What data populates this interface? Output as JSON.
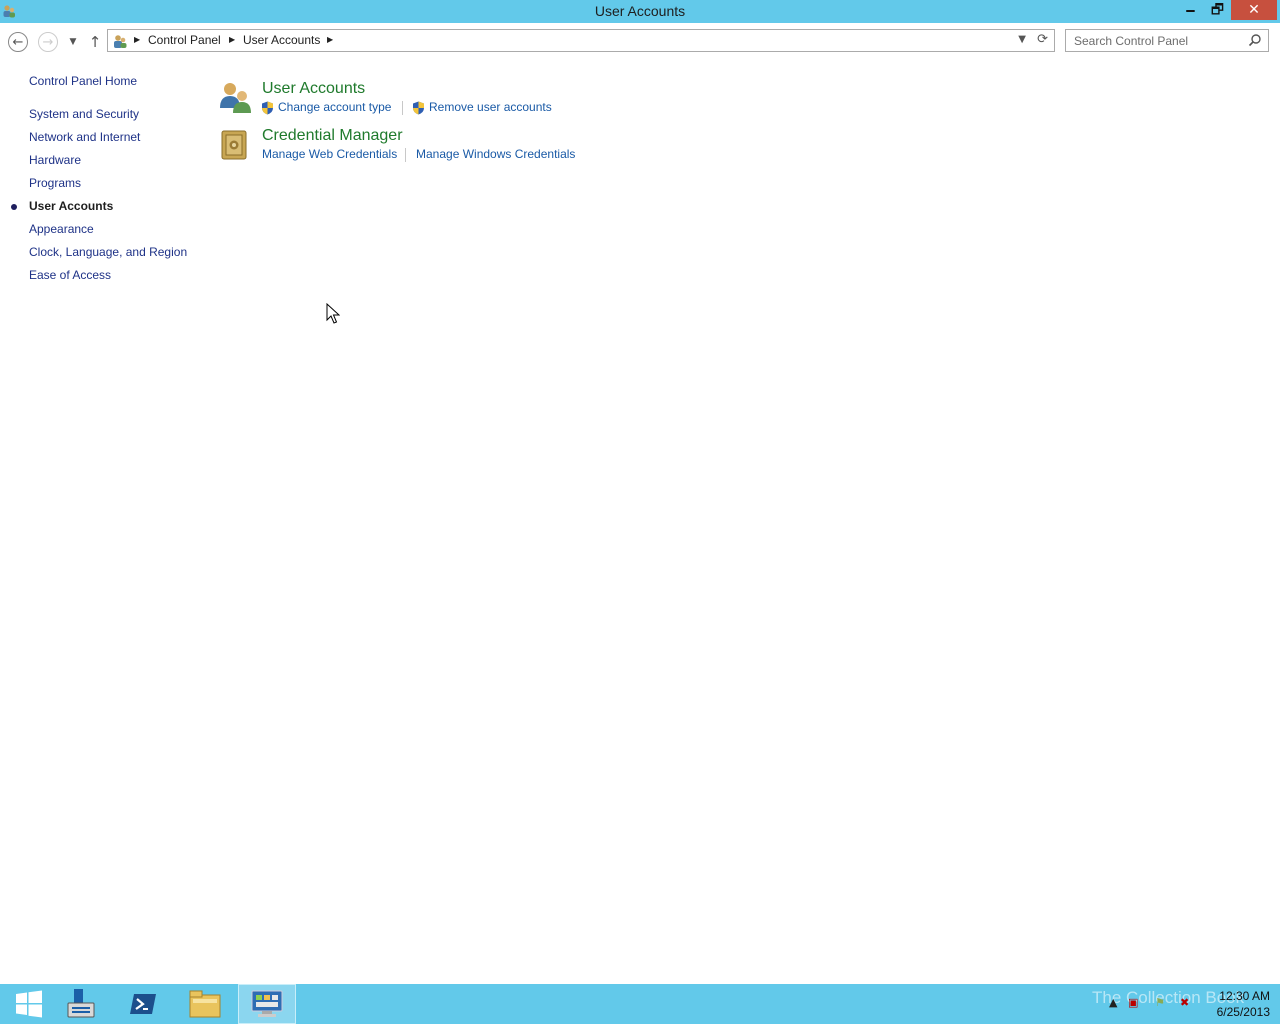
{
  "window": {
    "title": "User Accounts",
    "minimize_label": "🗕",
    "maximize_label": "🗗",
    "close_label": "✕"
  },
  "navigation": {
    "breadcrumbs": [
      "Control Panel",
      "User Accounts"
    ],
    "search_placeholder": "Search Control Panel"
  },
  "sidebar": {
    "home": "Control Panel Home",
    "items": [
      {
        "label": "System and Security",
        "active": false
      },
      {
        "label": "Network and Internet",
        "active": false
      },
      {
        "label": "Hardware",
        "active": false
      },
      {
        "label": "Programs",
        "active": false
      },
      {
        "label": "User Accounts",
        "active": true
      },
      {
        "label": "Appearance",
        "active": false
      },
      {
        "label": "Clock, Language, and Region",
        "active": false
      },
      {
        "label": "Ease of Access",
        "active": false
      }
    ]
  },
  "main": {
    "categories": [
      {
        "title": "User Accounts",
        "icon": "users-icon",
        "links": [
          "Change account type",
          "Remove user accounts"
        ]
      },
      {
        "title": "Credential Manager",
        "icon": "credential-vault-icon",
        "links": [
          "Manage Web Credentials",
          "Manage Windows Credentials"
        ]
      }
    ]
  },
  "taskbar": {
    "apps": [
      "start-icon",
      "server-manager-icon",
      "powershell-icon",
      "file-explorer-icon",
      "control-panel-icon"
    ],
    "watermark": "The Collection Book",
    "clock_time": "12:30 AM",
    "clock_date": "6/25/2013"
  },
  "colors": {
    "titlebar": "#62c9ea",
    "link": "#1a5aa6",
    "category_title": "#1f7a2c",
    "sidebar_link": "#1e3287"
  }
}
